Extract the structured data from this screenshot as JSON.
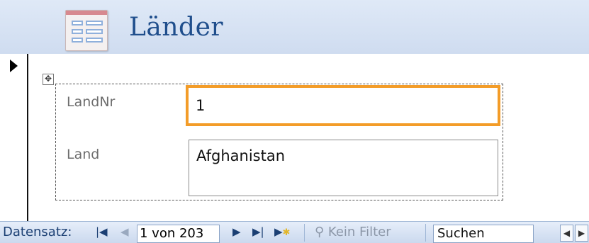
{
  "header": {
    "title": "Länder"
  },
  "form": {
    "fields": [
      {
        "label": "LandNr",
        "value": "1"
      },
      {
        "label": "Land",
        "value": "Afghanistan"
      }
    ]
  },
  "navigation": {
    "label": "Datensatz:",
    "record": "1 von 203",
    "filter_label": "Kein Filter",
    "search_label": "Suchen"
  },
  "colors": {
    "header_bg": "#d6e2f3",
    "title": "#1f4e8c",
    "active_field_border": "#f39c28"
  }
}
